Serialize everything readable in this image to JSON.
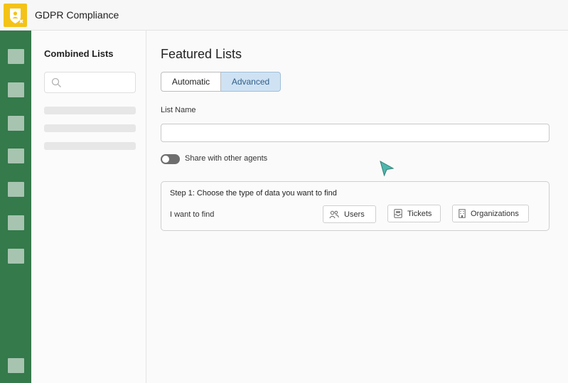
{
  "app": {
    "title": "GDPR Compliance",
    "logo_icon": "shield-user-icon",
    "accent": "#f4c318"
  },
  "rail": {
    "color": "#347a4b",
    "icon_color": "#a7c4b0",
    "item_count": 8
  },
  "sidepanel": {
    "title": "Combined Lists",
    "search": {
      "placeholder": "",
      "value": ""
    },
    "skeleton_rows": 3
  },
  "main": {
    "title": "Featured Lists",
    "mode_tabs": {
      "automatic": "Automatic",
      "advanced": "Advanced",
      "selected": "Advanced"
    },
    "list_name": {
      "label": "List Name",
      "value": ""
    },
    "share_toggle": {
      "label": "Share with other agents",
      "on": false
    },
    "step1": {
      "title": "Step 1: Choose the type of data you want to find",
      "prompt": "I want to find",
      "options": {
        "users": "Users",
        "tickets": "Tickets",
        "organizations": "Organizations"
      }
    }
  },
  "cursor": {
    "color": "#4fb6ad"
  }
}
